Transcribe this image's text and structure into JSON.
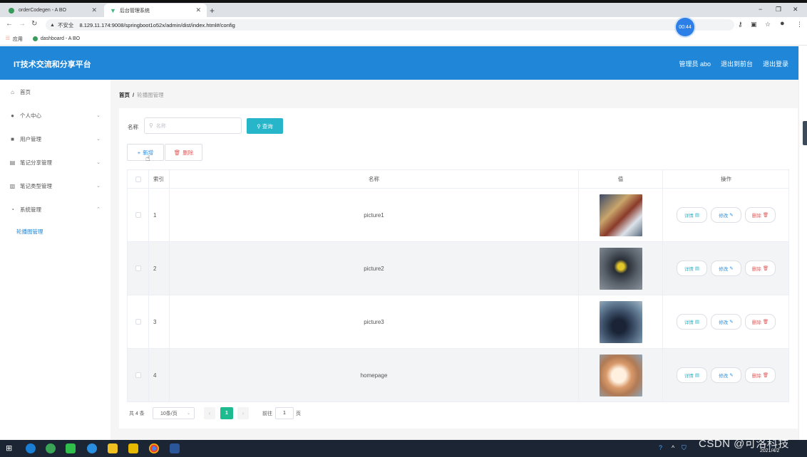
{
  "browser": {
    "tabs": [
      {
        "title": "orderCodegen - A BO",
        "active": false
      },
      {
        "title": "后台管理系统",
        "active": true
      }
    ],
    "url": "8.129.11.174:9008/springboot1o52x/admin/dist/index.html#/config",
    "insecure_label": "不安全",
    "timer": "00:44",
    "bookmarks": [
      {
        "label": "应用",
        "icon": "apps-grid-icon"
      },
      {
        "label": "dashboard - A BO",
        "icon": "site-favicon"
      }
    ]
  },
  "header": {
    "title": "IT技术交流和分享平台",
    "links": [
      "管理员 abo",
      "退出到前台",
      "退出登录"
    ],
    "color": "#1f86d8"
  },
  "sidebar": {
    "items": [
      {
        "label": "首页",
        "icon": "home-icon",
        "expandable": false
      },
      {
        "label": "个人中心",
        "icon": "user-icon",
        "expandable": true
      },
      {
        "label": "用户管理",
        "icon": "users-icon",
        "expandable": true
      },
      {
        "label": "笔记分享管理",
        "icon": "note-icon",
        "expandable": true
      },
      {
        "label": "笔记类型管理",
        "icon": "book-icon",
        "expandable": true
      },
      {
        "label": "系统管理",
        "icon": "settings-icon",
        "expandable": true,
        "expanded": true
      }
    ],
    "subitems": [
      {
        "label": "轮播图管理",
        "active": true
      }
    ]
  },
  "breadcrumb": {
    "home": "首页",
    "current": "轮播图管理"
  },
  "search": {
    "label": "名称",
    "placeholder": "名称",
    "query_button": "查询"
  },
  "actions": {
    "add": "新增",
    "delete": "删除"
  },
  "table": {
    "columns": [
      "索引",
      "名称",
      "值",
      "操作"
    ],
    "rows": [
      {
        "index": "1",
        "name": "picture1",
        "thumb": "cars-racing"
      },
      {
        "index": "2",
        "name": "picture2",
        "thumb": "yellow-car"
      },
      {
        "index": "3",
        "name": "picture3",
        "thumb": "dark-car"
      },
      {
        "index": "4",
        "name": "homepage",
        "thumb": "yawning-cat"
      }
    ],
    "row_actions": {
      "detail": "详情",
      "edit": "修改",
      "delete": "删除"
    }
  },
  "pagination": {
    "total": "共 4 条",
    "page_size": "10条/页",
    "current_page": "1",
    "goto_label": "前往",
    "goto_value": "1",
    "page_suffix": "页"
  },
  "taskbar": {
    "watermark": "CSDN @可洛科技",
    "date": "2021/4/2"
  },
  "colors": {
    "primary": "#1f86d8",
    "query": "#27b6c9",
    "danger": "#e05a5a",
    "page_active": "#1dbb8f"
  }
}
